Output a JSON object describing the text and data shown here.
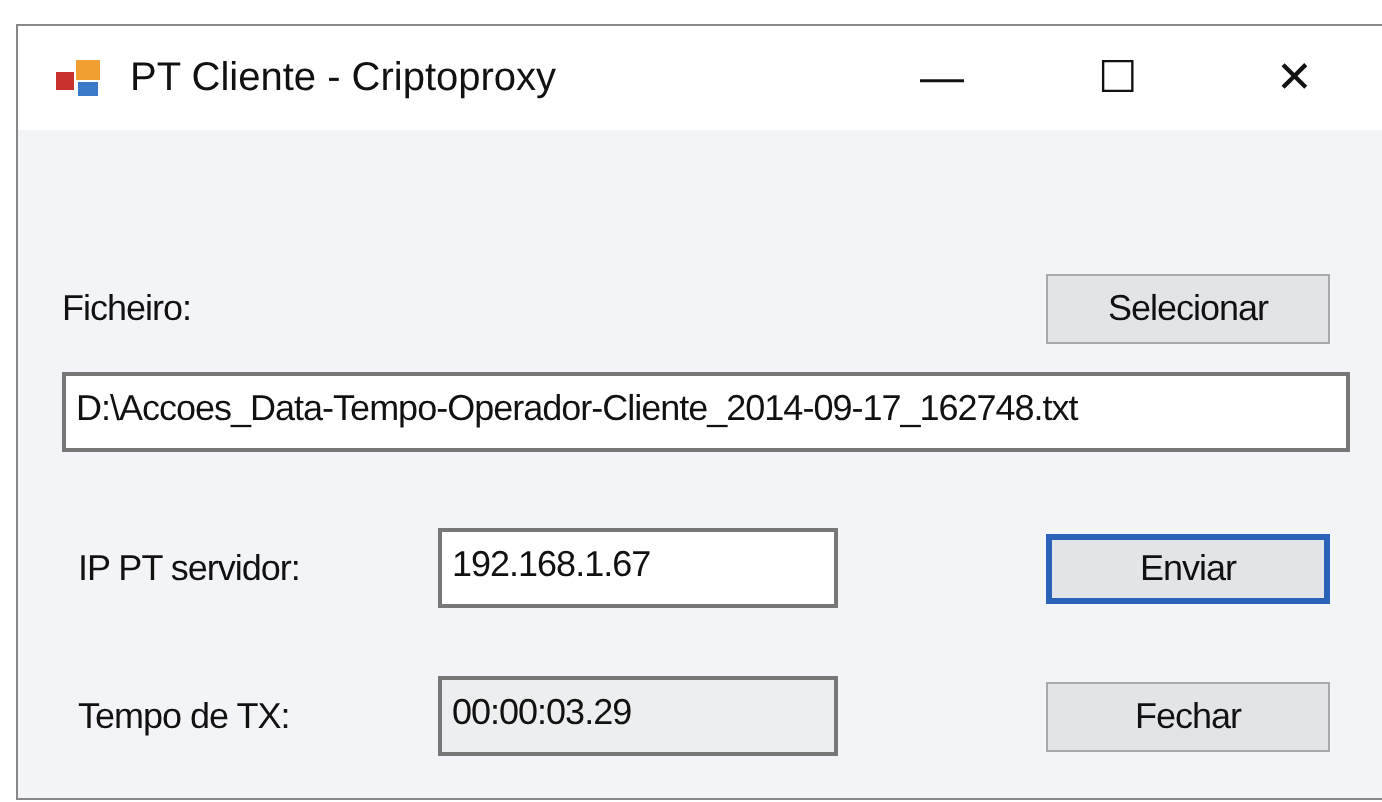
{
  "window": {
    "title": "PT Cliente - Criptoproxy",
    "controls": [
      "—",
      "☐",
      "✕"
    ]
  },
  "file": {
    "label": "Ficheiro:",
    "button": {
      "label": "Selecionar",
      "focused": false
    },
    "value": "D:\\Accoes_Data-Tempo-Operador-Cliente_2014-09-17_162748.txt",
    "readonly": false
  },
  "fields": [
    {
      "label": "IP PT servidor:",
      "value": "192.168.1.67",
      "readonly": false,
      "button": {
        "label": "Enviar",
        "focused": true
      }
    },
    {
      "label": "Tempo de TX:",
      "value": "00:00:03.29",
      "readonly": true,
      "button": {
        "label": "Fechar",
        "focused": false
      }
    }
  ]
}
